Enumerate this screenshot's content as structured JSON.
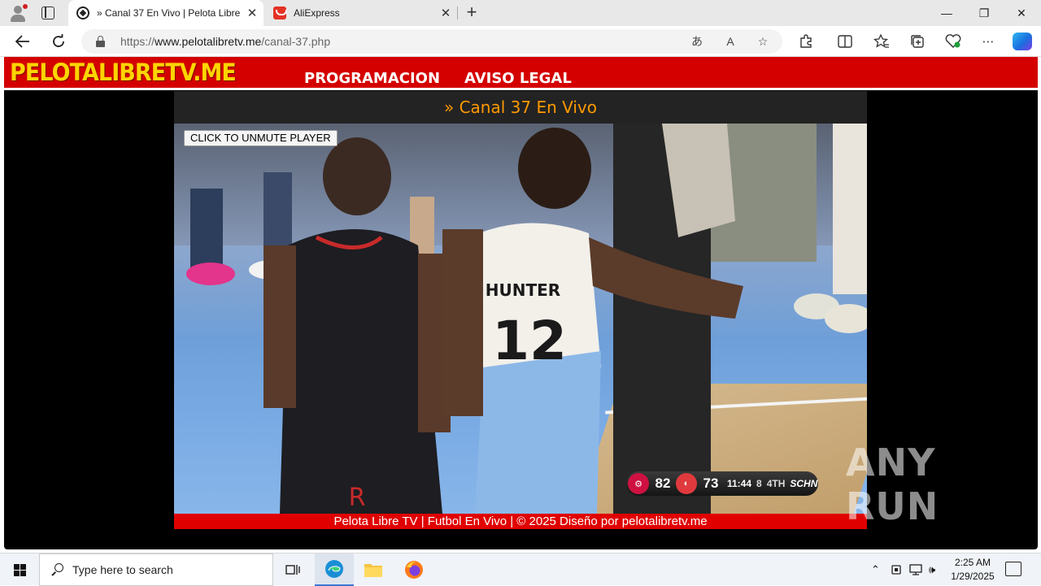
{
  "browser": {
    "tabs": [
      {
        "title": "» Canal 37 En Vivo | Pelota Libre TV",
        "favicon": "soccer-ball-icon",
        "active": true
      },
      {
        "title": "AliExpress",
        "favicon": "aliexpress-icon",
        "active": false
      }
    ],
    "new_tab_symbol": "+",
    "close_symbol": "✕",
    "window_controls": {
      "minimize": "—",
      "restore": "❐",
      "close": "✕"
    },
    "url": {
      "scheme": "https://",
      "host": "www.pelotalibretv.me",
      "path": "/canal-37.php"
    }
  },
  "site": {
    "logo": "PELOTALIBRETV.ME",
    "menu": [
      "PROGRAMACION",
      "AVISO LEGAL"
    ],
    "channel_title": "» Canal 37 En Vivo",
    "unmute_button": "CLICK TO UNMUTE PLAYER",
    "footer": "Pelota Libre TV | Futbol En Vivo | © 2025 Diseño por pelotalibretv.me",
    "colors": {
      "header": "#d40000",
      "logo": "#ffd400",
      "channel_title": "#ff9900",
      "footer": "#e00000"
    }
  },
  "video": {
    "jersey_name": "HUNTER",
    "jersey_number": "12",
    "scoreboard": {
      "home_score": "82",
      "away_score": "73",
      "clock": "11:44",
      "shot_clock": "8",
      "period": "4TH",
      "network": "SCHN"
    }
  },
  "watermark": "ANY RUN",
  "taskbar": {
    "search_placeholder": "Type here to search",
    "time": "2:25 AM",
    "date": "1/29/2025"
  }
}
